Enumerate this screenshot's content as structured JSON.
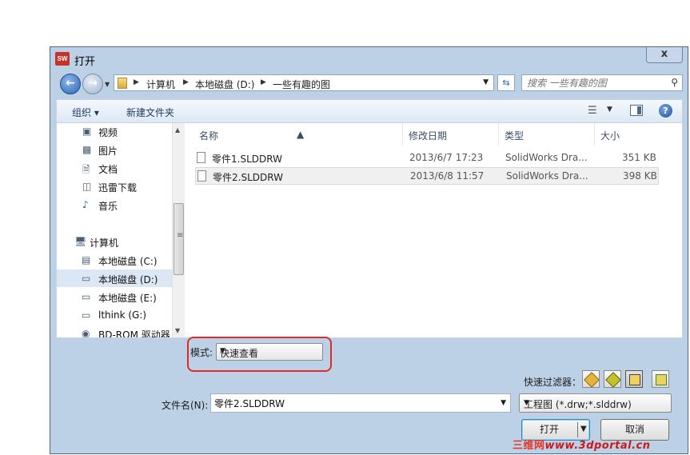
{
  "window": {
    "app_icon": "SW",
    "title": "打开",
    "close_label": "x"
  },
  "address": {
    "back_icon": "back-arrow",
    "forward_icon": "forward-arrow",
    "crumbs": [
      "计算机",
      "本地磁盘 (D:)",
      "一些有趣的图"
    ],
    "search_placeholder": "搜索 一些有趣的图"
  },
  "toolbar": {
    "organize_label": "组织 ▾",
    "new_folder_label": "新建文件夹"
  },
  "sidebar": {
    "items": [
      {
        "label": "视频",
        "icon": "video-icon"
      },
      {
        "label": "图片",
        "icon": "picture-icon"
      },
      {
        "label": "文档",
        "icon": "document-icon"
      },
      {
        "label": "迅雷下载",
        "icon": "download-icon"
      },
      {
        "label": "音乐",
        "icon": "music-icon"
      },
      {
        "label": "计算机",
        "icon": "computer-icon"
      },
      {
        "label": "本地磁盘 (C:)",
        "icon": "system-drive-icon"
      },
      {
        "label": "本地磁盘 (D:)",
        "icon": "drive-icon",
        "selected": true
      },
      {
        "label": "本地磁盘 (E:)",
        "icon": "drive-icon"
      },
      {
        "label": "lthink (G:)",
        "icon": "drive-icon"
      },
      {
        "label": "BD-ROM 驱动器",
        "icon": "disc-icon"
      }
    ]
  },
  "files": {
    "columns": [
      "名称",
      "修改日期",
      "类型",
      "大小"
    ],
    "rows": [
      {
        "name": "零件1.SLDDRW",
        "date": "2013/6/7 17:23",
        "type": "SolidWorks Dra...",
        "size": "351 KB"
      },
      {
        "name": "零件2.SLDDRW",
        "date": "2013/6/8 11:57",
        "type": "SolidWorks Dra...",
        "size": "398 KB",
        "selected": true
      }
    ]
  },
  "mode": {
    "label": "模式:",
    "value": "快速查看"
  },
  "quick_filter": {
    "label": "快速过滤器："
  },
  "filename": {
    "label": "文件名(N):",
    "value": "零件2.SLDDRW"
  },
  "filetype": {
    "value": "工程图 (*.drw;*.slddrw)"
  },
  "buttons": {
    "open_label": "打开",
    "cancel_label": "取消"
  },
  "watermark": {
    "site_cn": "三维网",
    "site_url": "www.3dportal.cn"
  },
  "colors": {
    "accent": "#2d64b5",
    "annotation": "#e12a2a",
    "chrome": "#bcd0e6"
  }
}
